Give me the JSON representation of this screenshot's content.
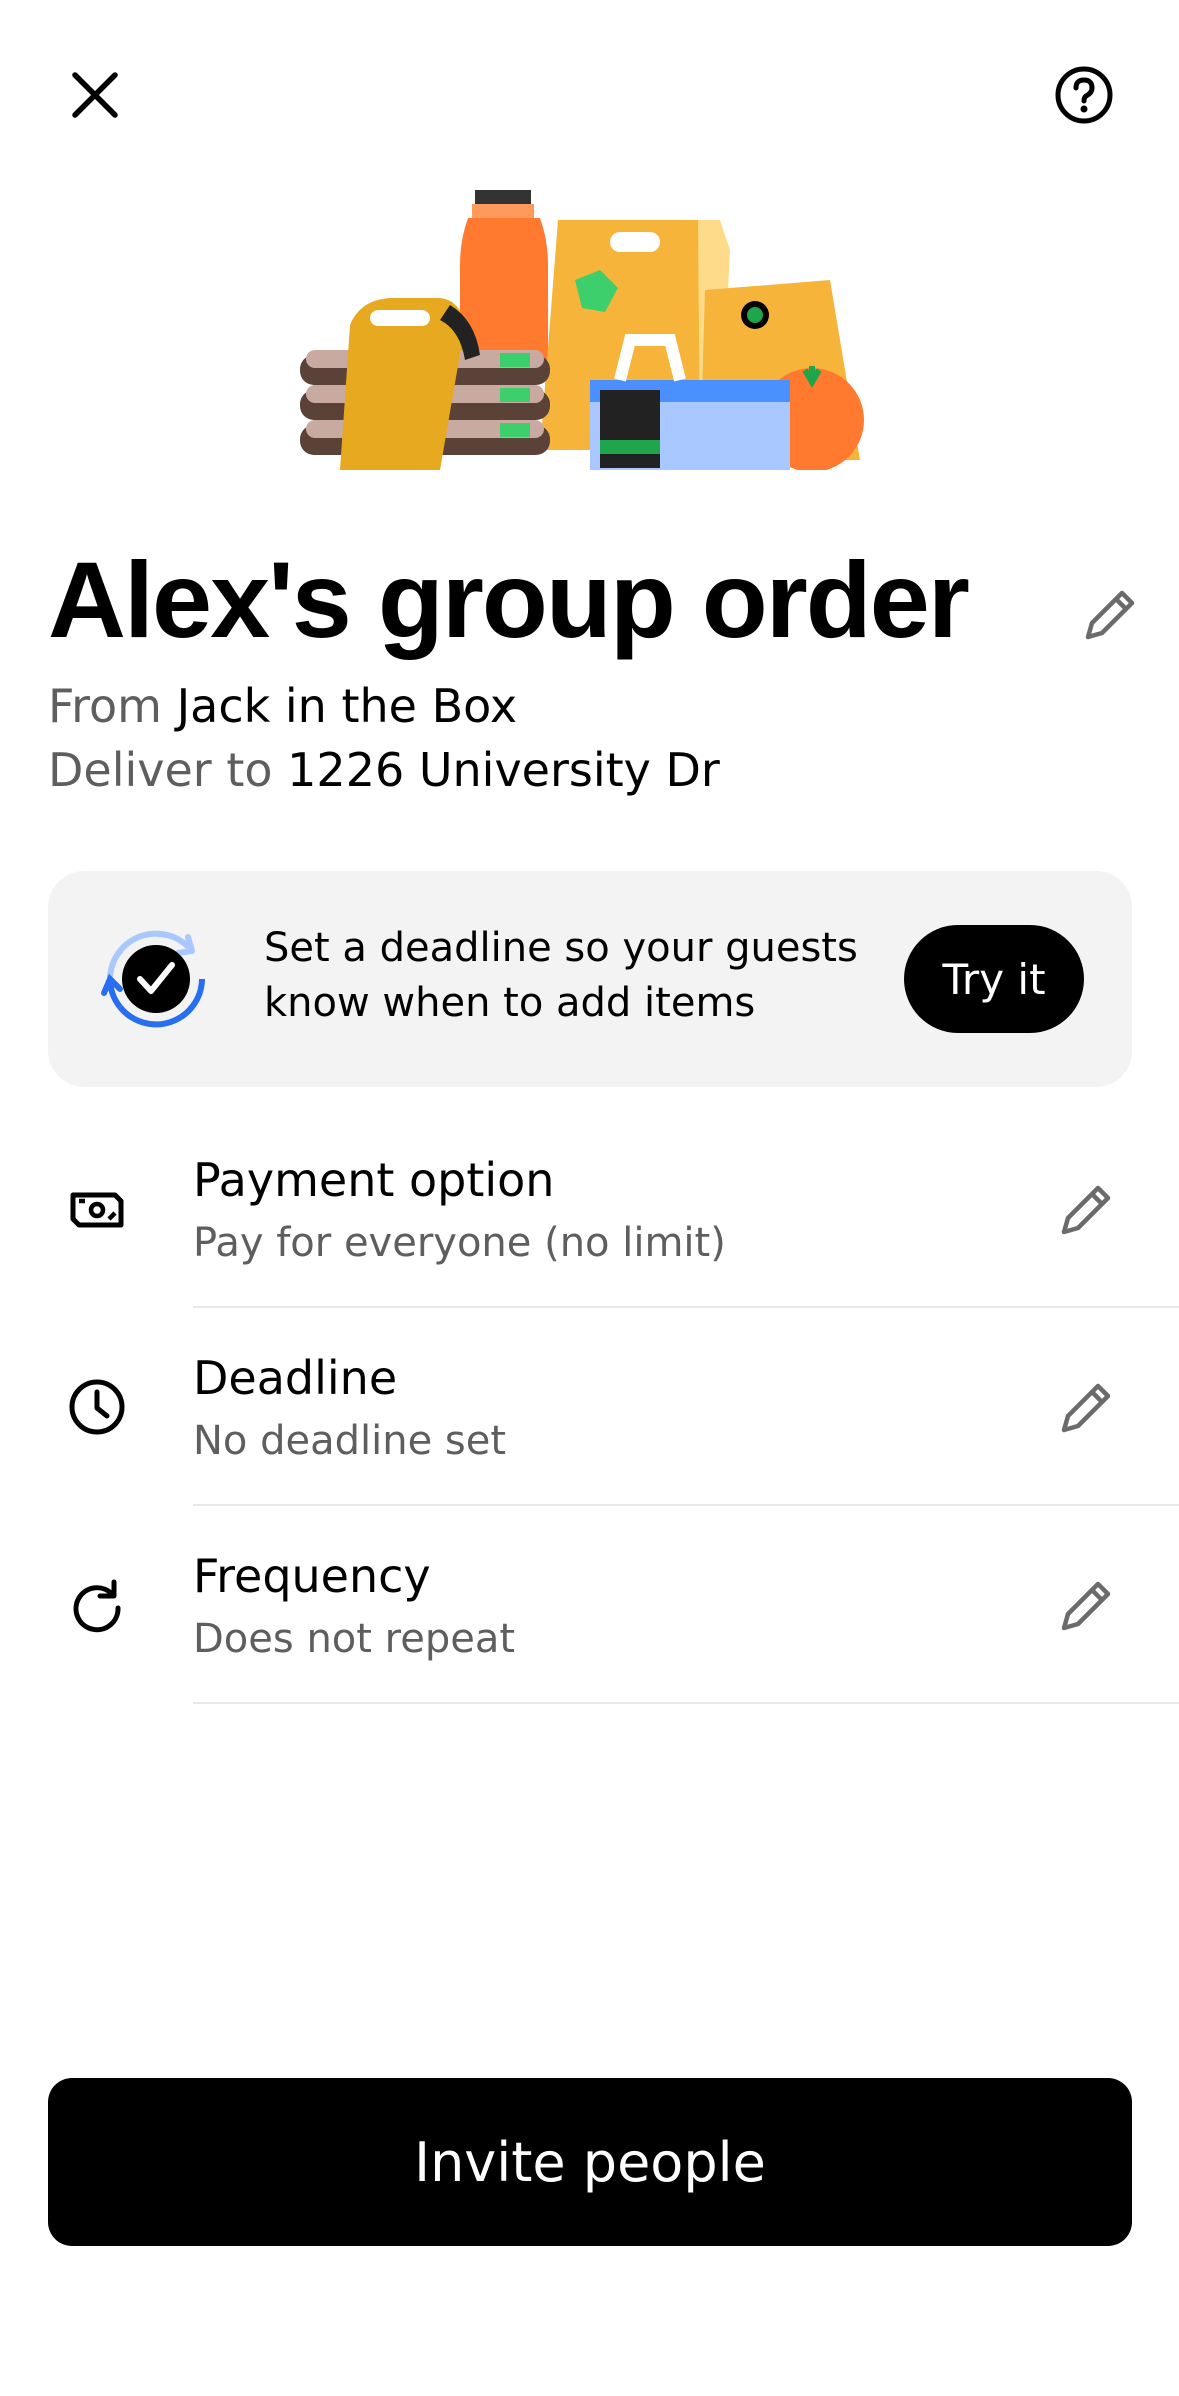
{
  "header": {
    "close_icon": "close-icon",
    "help_icon": "help-circle-icon"
  },
  "hero": {
    "illustration": "group-order-food-illustration"
  },
  "order": {
    "title": "Alex's group order",
    "edit_icon": "pencil-icon",
    "from_label": "From",
    "restaurant": "Jack in the Box",
    "deliver_label": "Deliver to",
    "address": "1226 University Dr"
  },
  "promo": {
    "icon": "deadline-check-icon",
    "text": "Set a deadline so your guests know when to add items",
    "button_label": "Try it",
    "accent_color": "#276EF1"
  },
  "options": [
    {
      "icon": "cash-icon",
      "title": "Payment option",
      "value": "Pay for everyone (no limit)",
      "edit_icon": "pencil-icon"
    },
    {
      "icon": "clock-icon",
      "title": "Deadline",
      "value": "No deadline set",
      "edit_icon": "pencil-icon"
    },
    {
      "icon": "repeat-icon",
      "title": "Frequency",
      "value": "Does not repeat",
      "edit_icon": "pencil-icon"
    }
  ],
  "footer": {
    "invite_label": "Invite people"
  },
  "colors": {
    "primary": "#000000",
    "secondary_text": "#5E5E5E",
    "promo_bg": "#F3F3F3"
  }
}
